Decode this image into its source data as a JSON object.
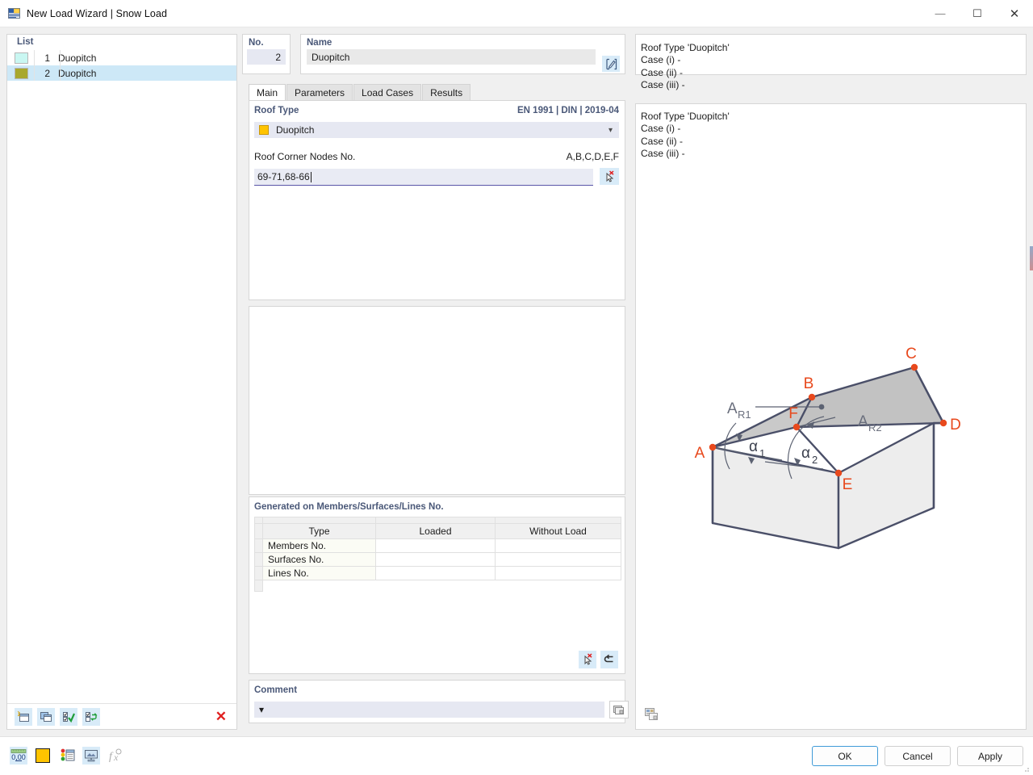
{
  "window": {
    "title": "New Load Wizard | Snow Load",
    "icon": "wizard-icon",
    "minimize": "—",
    "maximize": "☐",
    "close": "✕"
  },
  "list_panel": {
    "header": "List",
    "rows": [
      {
        "num": "1",
        "label": "Duopitch",
        "color": "#c9f7f2",
        "selected": false
      },
      {
        "num": "2",
        "label": "Duopitch",
        "color": "#a8a82e",
        "selected": true
      }
    ],
    "toolbar": [
      {
        "name": "new-item-icon",
        "glyph": "new"
      },
      {
        "name": "copy-item-icon",
        "glyph": "copy"
      },
      {
        "name": "check-all-icon",
        "glyph": "checkall"
      },
      {
        "name": "toggle-check-icon",
        "glyph": "toggle"
      },
      {
        "name": "delete-item-icon",
        "glyph": "✕"
      }
    ]
  },
  "header": {
    "no_label": "No.",
    "no_value": "2",
    "name_label": "Name",
    "name_value": "Duopitch",
    "name_edit_icon": "edit-pencil-icon"
  },
  "tabs": [
    {
      "label": "Main",
      "active": true
    },
    {
      "label": "Parameters",
      "active": false
    },
    {
      "label": "Load Cases",
      "active": false
    },
    {
      "label": "Results",
      "active": false
    }
  ],
  "main_tab": {
    "roof_type_label": "Roof Type",
    "standard": "EN 1991 | DIN | 2019-04",
    "roof_type_value": "Duopitch",
    "roof_type_swatch": "#ffc400",
    "roof_corner_label": "Roof Corner Nodes No.",
    "roof_corner_hint": "A,B,C,D,E,F",
    "roof_corner_value": "69-71,68-66",
    "pick_icon": "select-nodes-icon"
  },
  "generated": {
    "title": "Generated on Members/Surfaces/Lines No.",
    "columns": [
      "Type",
      "Loaded",
      "Without Load"
    ],
    "rows": [
      {
        "type": "Members No.",
        "loaded": "",
        "without_load": ""
      },
      {
        "type": "Surfaces No.",
        "loaded": "",
        "without_load": ""
      },
      {
        "type": "Lines No.",
        "loaded": "",
        "without_load": ""
      }
    ],
    "actions": [
      {
        "name": "select-objects-icon",
        "glyph": "pick"
      },
      {
        "name": "reset-icon",
        "glyph": "↩"
      }
    ]
  },
  "comment": {
    "label": "Comment",
    "value": "",
    "dropdown_arrow": "⌄",
    "button_icon": "comment-library-icon"
  },
  "info_panel": {
    "lines": [
      "Roof Type 'Duopitch'",
      "Case (i) -",
      "Case (ii) -",
      "Case (iii) -"
    ]
  },
  "diagram": {
    "name": "duopitch-roof-diagram",
    "node_labels": [
      "A",
      "B",
      "C",
      "D",
      "E",
      "F"
    ],
    "area_labels": [
      "A",
      "A"
    ],
    "area_subscripts": [
      "R1",
      "R2"
    ],
    "angle_labels": [
      "α",
      "α"
    ],
    "angle_subscripts": [
      "1",
      "2"
    ],
    "node_color": "#e8491d",
    "edge_color": "#4a4f68",
    "roof_fill_left": "#c8c8c8",
    "roof_fill_right": "#c0c0c0",
    "wall_fill": "#ededed",
    "image_button_icon": "image-export-icon"
  },
  "bottom_bar": {
    "tools": [
      {
        "name": "numeric-format-icon",
        "glyph": "0,00"
      },
      {
        "name": "color-swatch-icon",
        "glyph": "swatch",
        "color": "#ffc400"
      },
      {
        "name": "display-properties-icon",
        "glyph": "props"
      },
      {
        "name": "render-icon",
        "glyph": "render"
      },
      {
        "name": "formula-icon",
        "glyph": "fх"
      }
    ],
    "buttons": [
      {
        "label": "OK",
        "primary": true
      },
      {
        "label": "Cancel",
        "primary": false
      },
      {
        "label": "Apply",
        "primary": false
      }
    ]
  }
}
